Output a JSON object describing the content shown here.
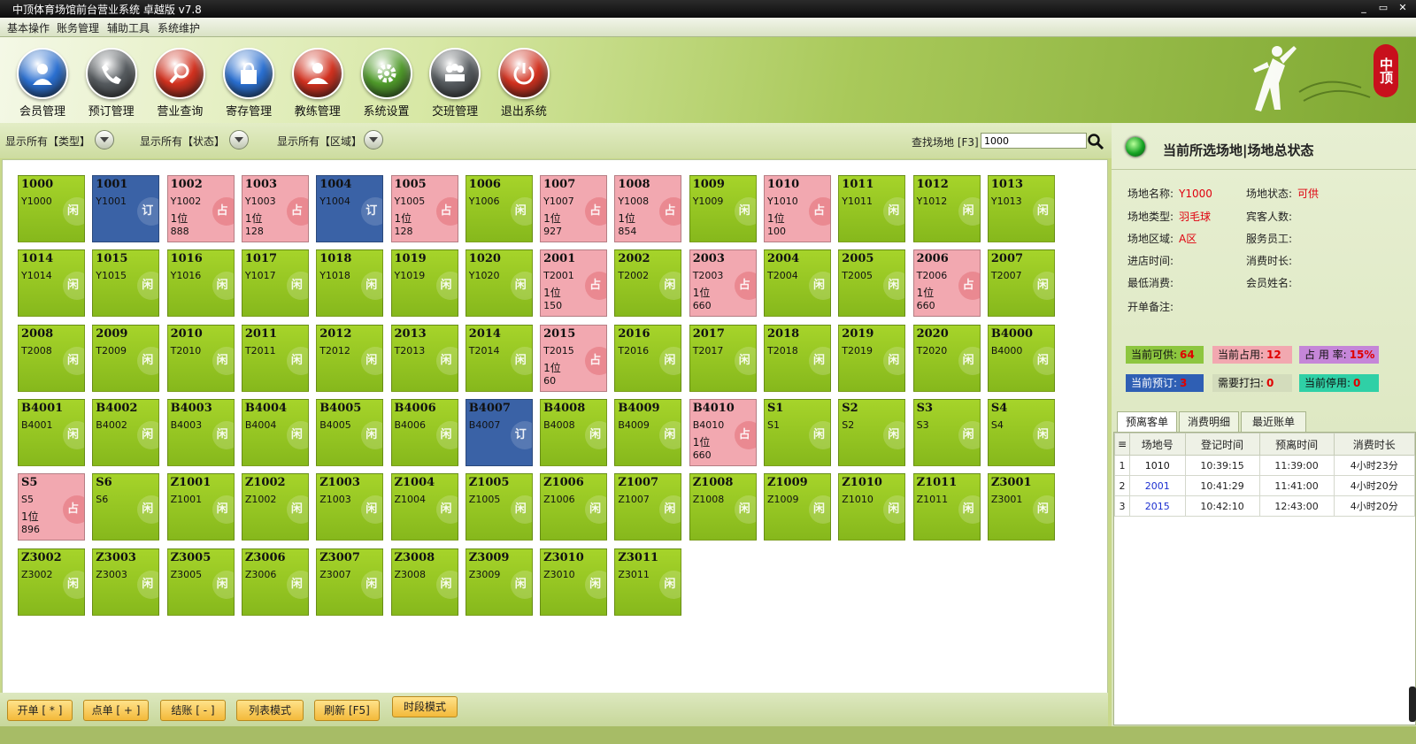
{
  "window": {
    "title": "中顶体育场馆前台营业系统 卓越版 v7.8",
    "buttons": [
      "_",
      "▭",
      "✕"
    ]
  },
  "menu": [
    "基本操作",
    "账务管理",
    "辅助工具",
    "系统维护"
  ],
  "toolbar": [
    {
      "label": "会员管理",
      "icon": "member-icon",
      "color": "#2a6fd0"
    },
    {
      "label": "预订管理",
      "icon": "phone-icon",
      "color": "#555a5e"
    },
    {
      "label": "营业查询",
      "icon": "magnifier-icon",
      "color": "#d1311f"
    },
    {
      "label": "寄存管理",
      "icon": "bag-icon",
      "color": "#2a6fd0"
    },
    {
      "label": "教练管理",
      "icon": "coach-icon",
      "color": "#d1311f"
    },
    {
      "label": "系统设置",
      "icon": "gear-icon",
      "color": "#4f9a2a"
    },
    {
      "label": "交班管理",
      "icon": "team-icon",
      "color": "#555a5e"
    },
    {
      "label": "退出系统",
      "icon": "power-icon",
      "color": "#d1311f"
    }
  ],
  "logo": {
    "text": "中顶"
  },
  "filters": [
    {
      "label": "显示所有【类型】"
    },
    {
      "label": "显示所有【状态】"
    },
    {
      "label": "显示所有【区域】"
    }
  ],
  "search": {
    "label": "查找场地 [F3]",
    "value": "1000"
  },
  "status_glyphs": {
    "free": "闲",
    "occupied": "占",
    "reserved": "订"
  },
  "tiles": [
    {
      "n": "1000",
      "c": "Y1000",
      "s": "free"
    },
    {
      "n": "1001",
      "c": "Y1001",
      "s": "reserved"
    },
    {
      "n": "1002",
      "c": "Y1002",
      "s": "occupied",
      "p": "1位",
      "a": "888"
    },
    {
      "n": "1003",
      "c": "Y1003",
      "s": "occupied",
      "p": "1位",
      "a": "128"
    },
    {
      "n": "1004",
      "c": "Y1004",
      "s": "reserved"
    },
    {
      "n": "1005",
      "c": "Y1005",
      "s": "occupied",
      "p": "1位",
      "a": "128"
    },
    {
      "n": "1006",
      "c": "Y1006",
      "s": "free"
    },
    {
      "n": "1007",
      "c": "Y1007",
      "s": "occupied",
      "p": "1位",
      "a": "927"
    },
    {
      "n": "1008",
      "c": "Y1008",
      "s": "occupied",
      "p": "1位",
      "a": "854"
    },
    {
      "n": "1009",
      "c": "Y1009",
      "s": "free"
    },
    {
      "n": "1010",
      "c": "Y1010",
      "s": "occupied",
      "p": "1位",
      "a": "100"
    },
    {
      "n": "1011",
      "c": "Y1011",
      "s": "free"
    },
    {
      "n": "1012",
      "c": "Y1012",
      "s": "free"
    },
    {
      "n": "1013",
      "c": "Y1013",
      "s": "free"
    },
    {
      "n": "1014",
      "c": "Y1014",
      "s": "free"
    },
    {
      "n": "1015",
      "c": "Y1015",
      "s": "free"
    },
    {
      "n": "1016",
      "c": "Y1016",
      "s": "free"
    },
    {
      "n": "1017",
      "c": "Y1017",
      "s": "free"
    },
    {
      "n": "1018",
      "c": "Y1018",
      "s": "free"
    },
    {
      "n": "1019",
      "c": "Y1019",
      "s": "free"
    },
    {
      "n": "1020",
      "c": "Y1020",
      "s": "free"
    },
    {
      "n": "2001",
      "c": "T2001",
      "s": "occupied",
      "p": "1位",
      "a": "150"
    },
    {
      "n": "2002",
      "c": "T2002",
      "s": "free"
    },
    {
      "n": "2003",
      "c": "T2003",
      "s": "occupied",
      "p": "1位",
      "a": "660"
    },
    {
      "n": "2004",
      "c": "T2004",
      "s": "free"
    },
    {
      "n": "2005",
      "c": "T2005",
      "s": "free"
    },
    {
      "n": "2006",
      "c": "T2006",
      "s": "occupied",
      "p": "1位",
      "a": "660"
    },
    {
      "n": "2007",
      "c": "T2007",
      "s": "free"
    },
    {
      "n": "2008",
      "c": "T2008",
      "s": "free"
    },
    {
      "n": "2009",
      "c": "T2009",
      "s": "free"
    },
    {
      "n": "2010",
      "c": "T2010",
      "s": "free"
    },
    {
      "n": "2011",
      "c": "T2011",
      "s": "free"
    },
    {
      "n": "2012",
      "c": "T2012",
      "s": "free"
    },
    {
      "n": "2013",
      "c": "T2013",
      "s": "free"
    },
    {
      "n": "2014",
      "c": "T2014",
      "s": "free"
    },
    {
      "n": "2015",
      "c": "T2015",
      "s": "occupied",
      "p": "1位",
      "a": "60"
    },
    {
      "n": "2016",
      "c": "T2016",
      "s": "free"
    },
    {
      "n": "2017",
      "c": "T2017",
      "s": "free"
    },
    {
      "n": "2018",
      "c": "T2018",
      "s": "free"
    },
    {
      "n": "2019",
      "c": "T2019",
      "s": "free"
    },
    {
      "n": "2020",
      "c": "T2020",
      "s": "free"
    },
    {
      "n": "B4000",
      "c": "B4000",
      "s": "free"
    },
    {
      "n": "B4001",
      "c": "B4001",
      "s": "free"
    },
    {
      "n": "B4002",
      "c": "B4002",
      "s": "free"
    },
    {
      "n": "B4003",
      "c": "B4003",
      "s": "free"
    },
    {
      "n": "B4004",
      "c": "B4004",
      "s": "free"
    },
    {
      "n": "B4005",
      "c": "B4005",
      "s": "free"
    },
    {
      "n": "B4006",
      "c": "B4006",
      "s": "free"
    },
    {
      "n": "B4007",
      "c": "B4007",
      "s": "reserved"
    },
    {
      "n": "B4008",
      "c": "B4008",
      "s": "free"
    },
    {
      "n": "B4009",
      "c": "B4009",
      "s": "free"
    },
    {
      "n": "B4010",
      "c": "B4010",
      "s": "occupied",
      "p": "1位",
      "a": "660"
    },
    {
      "n": "S1",
      "c": "S1",
      "s": "free"
    },
    {
      "n": "S2",
      "c": "S2",
      "s": "free"
    },
    {
      "n": "S3",
      "c": "S3",
      "s": "free"
    },
    {
      "n": "S4",
      "c": "S4",
      "s": "free"
    },
    {
      "n": "S5",
      "c": "S5",
      "s": "occupied",
      "p": "1位",
      "a": "896"
    },
    {
      "n": "S6",
      "c": "S6",
      "s": "free"
    },
    {
      "n": "Z1001",
      "c": "Z1001",
      "s": "free"
    },
    {
      "n": "Z1002",
      "c": "Z1002",
      "s": "free"
    },
    {
      "n": "Z1003",
      "c": "Z1003",
      "s": "free"
    },
    {
      "n": "Z1004",
      "c": "Z1004",
      "s": "free"
    },
    {
      "n": "Z1005",
      "c": "Z1005",
      "s": "free"
    },
    {
      "n": "Z1006",
      "c": "Z1006",
      "s": "free"
    },
    {
      "n": "Z1007",
      "c": "Z1007",
      "s": "free"
    },
    {
      "n": "Z1008",
      "c": "Z1008",
      "s": "free"
    },
    {
      "n": "Z1009",
      "c": "Z1009",
      "s": "free"
    },
    {
      "n": "Z1010",
      "c": "Z1010",
      "s": "free"
    },
    {
      "n": "Z1011",
      "c": "Z1011",
      "s": "free"
    },
    {
      "n": "Z3001",
      "c": "Z3001",
      "s": "free"
    },
    {
      "n": "Z3002",
      "c": "Z3002",
      "s": "free"
    },
    {
      "n": "Z3003",
      "c": "Z3003",
      "s": "free"
    },
    {
      "n": "Z3005",
      "c": "Z3005",
      "s": "free"
    },
    {
      "n": "Z3006",
      "c": "Z3006",
      "s": "free"
    },
    {
      "n": "Z3007",
      "c": "Z3007",
      "s": "free"
    },
    {
      "n": "Z3008",
      "c": "Z3008",
      "s": "free"
    },
    {
      "n": "Z3009",
      "c": "Z3009",
      "s": "free"
    },
    {
      "n": "Z3010",
      "c": "Z3010",
      "s": "free"
    },
    {
      "n": "Z3011",
      "c": "Z3011",
      "s": "free"
    }
  ],
  "bottom_buttons": [
    "开单 [ * ]",
    "点单 [ + ]",
    "结账 [ - ]",
    "列表模式",
    "刷新 [F5]",
    "时段模式"
  ],
  "panel": {
    "title": "当前所选场地|场地总状态",
    "details": [
      {
        "label": "场地名称:",
        "value": "Y1000"
      },
      {
        "label": "场地状态:",
        "value": "可供"
      },
      {
        "label": "场地类型:",
        "value": "羽毛球"
      },
      {
        "label": "宾客人数:",
        "value": ""
      },
      {
        "label": "场地区域:",
        "value": "A区"
      },
      {
        "label": "服务员工:",
        "value": ""
      },
      {
        "label": "进店时间:",
        "value": ""
      },
      {
        "label": "消费时长:",
        "value": ""
      },
      {
        "label": "最低消费:",
        "value": ""
      },
      {
        "label": "会员姓名:",
        "value": ""
      },
      {
        "label": "开单备注:",
        "value": ""
      }
    ],
    "stats": [
      {
        "label": "当前可供:",
        "value": "64",
        "bg": "#8dc63f",
        "color": "#e00000"
      },
      {
        "label": "当前占用:",
        "value": "12",
        "bg": "#f2a8b0",
        "color": "#e00000"
      },
      {
        "label": "占 用 率:",
        "value": "15%",
        "bg": "#c586d8",
        "color": "#e00000"
      },
      {
        "label": "当前预订:",
        "value": "3",
        "bg": "#2f5fb4",
        "color": "#e00000"
      },
      {
        "label": "需要打扫:",
        "value": "0",
        "bg": "#d3dcbc",
        "color": "#e00000"
      },
      {
        "label": "当前停用:",
        "value": "0",
        "bg": "#2fd0a6",
        "color": "#e00000"
      }
    ],
    "tabs": [
      "预离客单",
      "消费明细",
      "最近账单"
    ],
    "recent": {
      "headers": [
        "场地号",
        "登记时间",
        "预离时间",
        "消费时长"
      ],
      "rows": [
        {
          "i": "1",
          "site": "1010",
          "reg": "10:39:15",
          "leave": "11:39:00",
          "dur": "4小时23分",
          "site_color": "#111"
        },
        {
          "i": "2",
          "site": "2001",
          "reg": "10:41:29",
          "leave": "11:41:00",
          "dur": "4小时20分",
          "site_color": "#1c2fd0"
        },
        {
          "i": "3",
          "site": "2015",
          "reg": "10:42:10",
          "leave": "12:43:00",
          "dur": "4小时20分",
          "site_color": "#1c2fd0"
        }
      ]
    }
  }
}
